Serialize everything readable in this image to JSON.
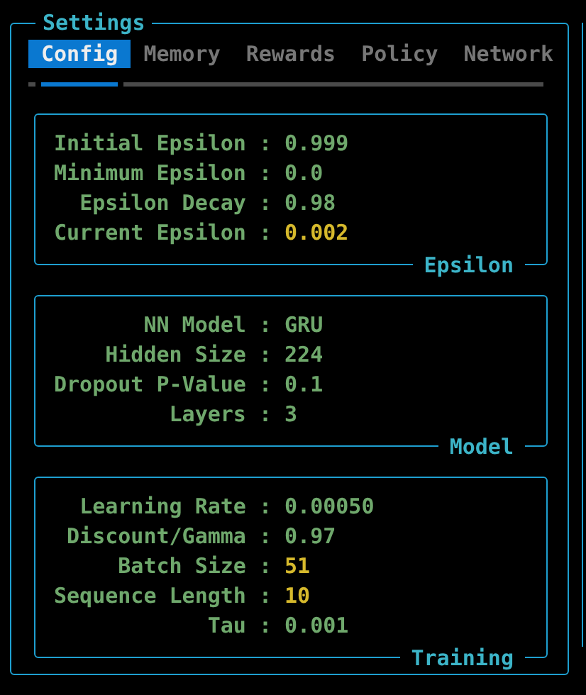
{
  "window": {
    "title": "Settings"
  },
  "tabs": [
    {
      "label": "Config",
      "selected": true
    },
    {
      "label": "Memory",
      "selected": false
    },
    {
      "label": "Rewards",
      "selected": false
    },
    {
      "label": "Policy",
      "selected": false
    },
    {
      "label": "Network",
      "selected": false
    }
  ],
  "panels": [
    {
      "title": "Epsilon",
      "rows": [
        {
          "label": "Initial Epsilon :",
          "value": "0.999",
          "highlighted": false
        },
        {
          "label": "Minimum Epsilon :",
          "value": "0.0",
          "highlighted": false
        },
        {
          "label": "Epsilon Decay :",
          "value": "0.98",
          "highlighted": false
        },
        {
          "label": "Current Epsilon :",
          "value": "0.002",
          "highlighted": true
        }
      ]
    },
    {
      "title": "Model",
      "rows": [
        {
          "label": "NN Model :",
          "value": "GRU",
          "highlighted": false
        },
        {
          "label": "Hidden Size :",
          "value": "224",
          "highlighted": false
        },
        {
          "label": "Dropout P-Value :",
          "value": "0.1",
          "highlighted": false
        },
        {
          "label": "Layers :",
          "value": "3",
          "highlighted": false
        }
      ]
    },
    {
      "title": "Training",
      "rows": [
        {
          "label": "Learning Rate :",
          "value": "0.00050",
          "highlighted": false
        },
        {
          "label": "Discount/Gamma :",
          "value": "0.97",
          "highlighted": false
        },
        {
          "label": "Batch Size :",
          "value": "51",
          "highlighted": true
        },
        {
          "label": "Sequence Length :",
          "value": "10",
          "highlighted": true
        },
        {
          "label": "Tau :",
          "value": "0.001",
          "highlighted": false
        }
      ]
    }
  ]
}
